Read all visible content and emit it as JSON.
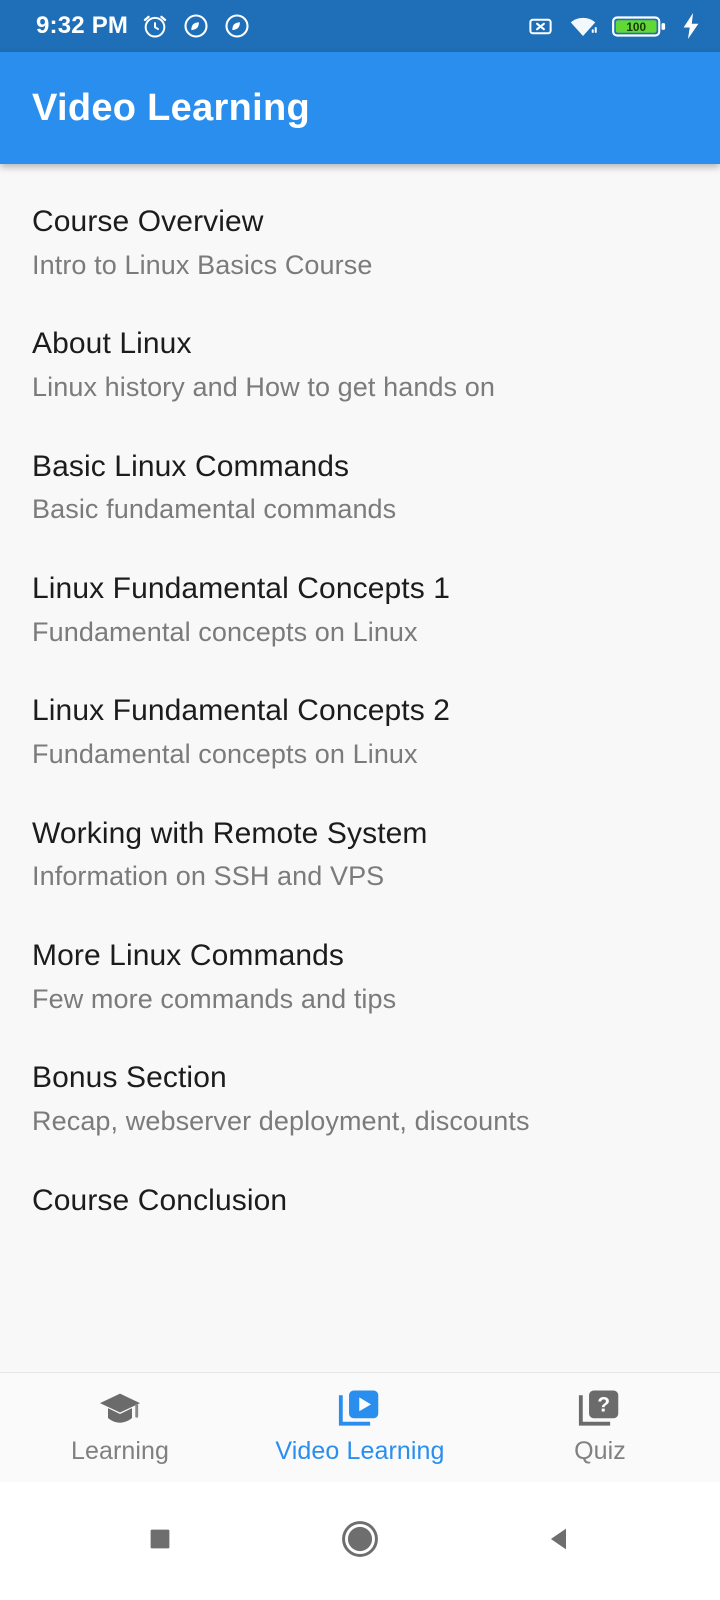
{
  "status_bar": {
    "time": "9:32 PM",
    "left_icons": [
      "alarm-icon",
      "do-not-disturb-icon",
      "do-not-disturb-icon"
    ],
    "right_icons": [
      "sim-card-missing-icon",
      "wifi-icon",
      "battery-icon",
      "charging-bolt-icon"
    ],
    "battery_level": "100",
    "background_color": "#1f6fb8"
  },
  "app_bar": {
    "title": "Video Learning",
    "background_color": "#2a8eee",
    "text_color": "#ffffff"
  },
  "content": {
    "items": [
      {
        "title": "Course Overview",
        "subtitle": "Intro to Linux Basics Course"
      },
      {
        "title": "About Linux",
        "subtitle": "Linux history and How to get hands on"
      },
      {
        "title": "Basic Linux Commands",
        "subtitle": "Basic fundamental commands"
      },
      {
        "title": "Linux Fundamental Concepts 1",
        "subtitle": "Fundamental concepts on Linux"
      },
      {
        "title": "Linux Fundamental Concepts 2",
        "subtitle": "Fundamental concepts on Linux"
      },
      {
        "title": "Working with Remote System",
        "subtitle": "Information on SSH and VPS"
      },
      {
        "title": "More Linux Commands",
        "subtitle": "Few more commands and tips"
      },
      {
        "title": "Bonus Section",
        "subtitle": "Recap, webserver deployment, discounts"
      },
      {
        "title": "Course Conclusion",
        "subtitle": ""
      }
    ]
  },
  "bottom_nav": {
    "active_color": "#2a8eee",
    "inactive_color": "#808080",
    "items": [
      {
        "label": "Learning",
        "icon": "graduation-cap-icon",
        "active": false
      },
      {
        "label": "Video Learning",
        "icon": "video-library-icon",
        "active": true
      },
      {
        "label": "Quiz",
        "icon": "quiz-library-icon",
        "active": false
      }
    ]
  },
  "system_nav": {
    "items": [
      {
        "name": "recents-button",
        "icon": "square-icon"
      },
      {
        "name": "home-button",
        "icon": "circle-icon"
      },
      {
        "name": "back-button",
        "icon": "triangle-left-icon"
      }
    ]
  }
}
